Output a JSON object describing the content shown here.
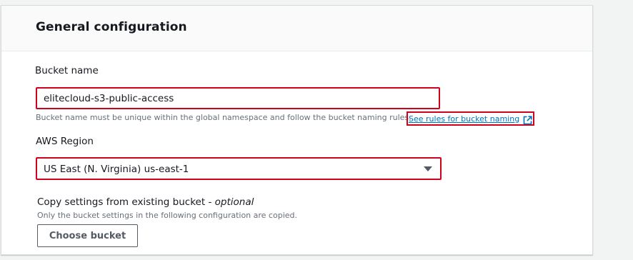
{
  "section": {
    "title": "General configuration"
  },
  "bucket_name": {
    "label": "Bucket name",
    "value": "elitecloud-s3-public-access",
    "hint": "Bucket name must be unique within the global namespace and follow the bucket naming rules.",
    "rules_link": "See rules for bucket naming",
    "rules_link_icon": "external-link-icon"
  },
  "region": {
    "label": "AWS Region",
    "selected": "US East (N. Virginia) us-east-1",
    "dropdown_icon": "caret-down-icon"
  },
  "copy_settings": {
    "label": "Copy settings from existing bucket - ",
    "optional": "optional",
    "hint": "Only the bucket settings in the following configuration are copied.",
    "button": "Choose bucket"
  },
  "colors": {
    "highlight_border": "#d0021b",
    "link": "#0073bb",
    "hint_text": "#687078",
    "panel_header_bg": "#fafafa"
  }
}
